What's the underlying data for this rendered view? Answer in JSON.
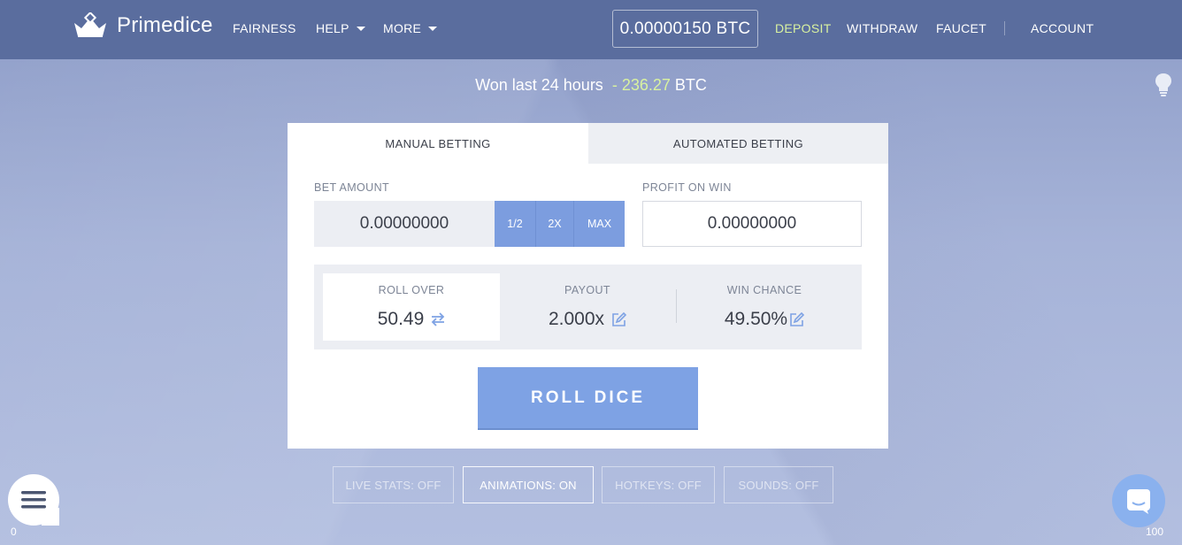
{
  "header": {
    "logo_text": "Primedice",
    "nav": {
      "fairness": "FAIRNESS",
      "help": "HELP",
      "more": "MORE",
      "deposit": "DEPOSIT",
      "withdraw": "WITHDRAW",
      "faucet": "FAUCET",
      "account": "ACCOUNT"
    },
    "balance": "0.00000150 BTC"
  },
  "won_strip": {
    "prefix": "Won last 24 hours",
    "dash": "-",
    "amount": "236.27",
    "currency": "BTC"
  },
  "tabs": {
    "manual": "MANUAL BETTING",
    "automated": "AUTOMATED BETTING"
  },
  "bet": {
    "label": "BET AMOUNT",
    "value": "0.00000000",
    "half": "1/2",
    "double": "2X",
    "max": "MAX"
  },
  "profit": {
    "label": "PROFIT ON WIN",
    "value": "0.00000000"
  },
  "stats": {
    "roll_over_label": "ROLL OVER",
    "roll_over_value": "50.49",
    "payout_label": "PAYOUT",
    "payout_value": "2.000x",
    "win_chance_label": "WIN CHANCE",
    "win_chance_value": "49.50%"
  },
  "roll_button": "ROLL DICE",
  "toggles": {
    "live_stats": "LIVE STATS: OFF",
    "animations": "ANIMATIONS: ON",
    "hotkeys": "HOTKEYS: OFF",
    "sounds": "SOUNDS: OFF"
  },
  "slider": {
    "min": "0",
    "max": "100"
  },
  "colors": {
    "header_bg": "#5a6d9e",
    "accent_blue": "#7ea2e4",
    "deposit_green": "#d9f2a0"
  }
}
